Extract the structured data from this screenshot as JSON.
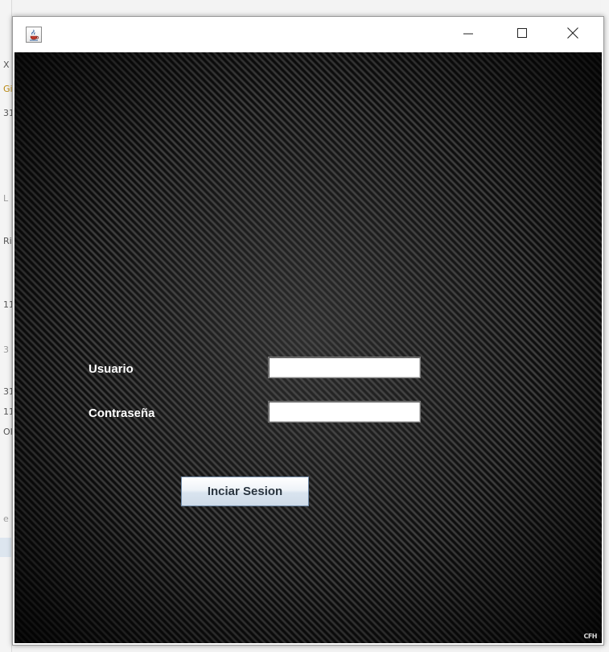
{
  "window": {
    "title": "",
    "controls": {
      "minimize": "minimize-icon",
      "maximize": "maximize-icon",
      "close": "close-icon"
    },
    "app_icon": "java-cup-icon"
  },
  "login_form": {
    "user_label": "Usuario",
    "user_value": "",
    "password_label": "Contraseña",
    "password_value": "",
    "submit_label": "Inciar Sesion"
  },
  "background_fragments": [
    "X",
    "Gi",
    "31",
    "L",
    "Ri",
    "11",
    "3",
    "31",
    "11",
    "OI",
    "e"
  ],
  "corner_mark": "CFH",
  "colors": {
    "panel_dark": "#1c1c1c",
    "label_text": "#ffffff",
    "button_border": "#6f8aa8",
    "button_text": "#2a3540",
    "field_bg": "#ffffff"
  }
}
